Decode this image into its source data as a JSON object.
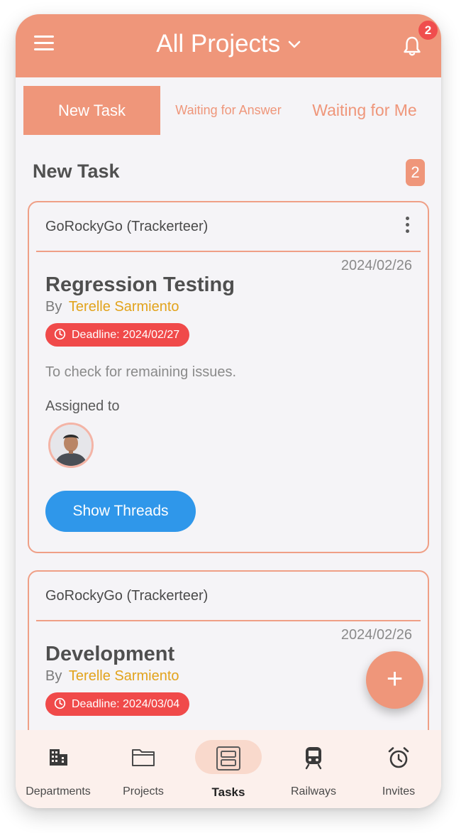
{
  "header": {
    "title": "All Projects",
    "notification_count": "2"
  },
  "tabs": [
    {
      "label": "New Task",
      "active": true
    },
    {
      "label": "Waiting for Answer",
      "active": false
    },
    {
      "label": "Waiting for Me",
      "active": false
    }
  ],
  "section": {
    "title": "New Task",
    "count": "2"
  },
  "tasks": [
    {
      "project": "GoRockyGo (Trackerteer)",
      "date": "2024/02/26",
      "title": "Regression Testing",
      "by_label": "By",
      "author": "Terelle Sarmiento",
      "deadline": "Deadline: 2024/02/27",
      "description": "To check for remaining issues.",
      "assigned_label": "Assigned to",
      "threads_button": "Show Threads"
    },
    {
      "project": "GoRockyGo (Trackerteer)",
      "date": "2024/02/26",
      "title": "Development",
      "by_label": "By",
      "author": "Terelle Sarmiento",
      "deadline": "Deadline: 2024/03/04"
    }
  ],
  "fab": {
    "icon": "plus-icon",
    "label": "+"
  },
  "bottom_nav": [
    {
      "label": "Departments",
      "icon": "building-icon"
    },
    {
      "label": "Projects",
      "icon": "folder-icon"
    },
    {
      "label": "Tasks",
      "icon": "tasks-icon",
      "active": true
    },
    {
      "label": "Railways",
      "icon": "train-icon"
    },
    {
      "label": "Invites",
      "icon": "alarm-clock-icon"
    }
  ],
  "colors": {
    "accent": "#ef967a",
    "deadline": "#f04a4a",
    "button": "#2f97ea",
    "author": "#e2a31c"
  }
}
